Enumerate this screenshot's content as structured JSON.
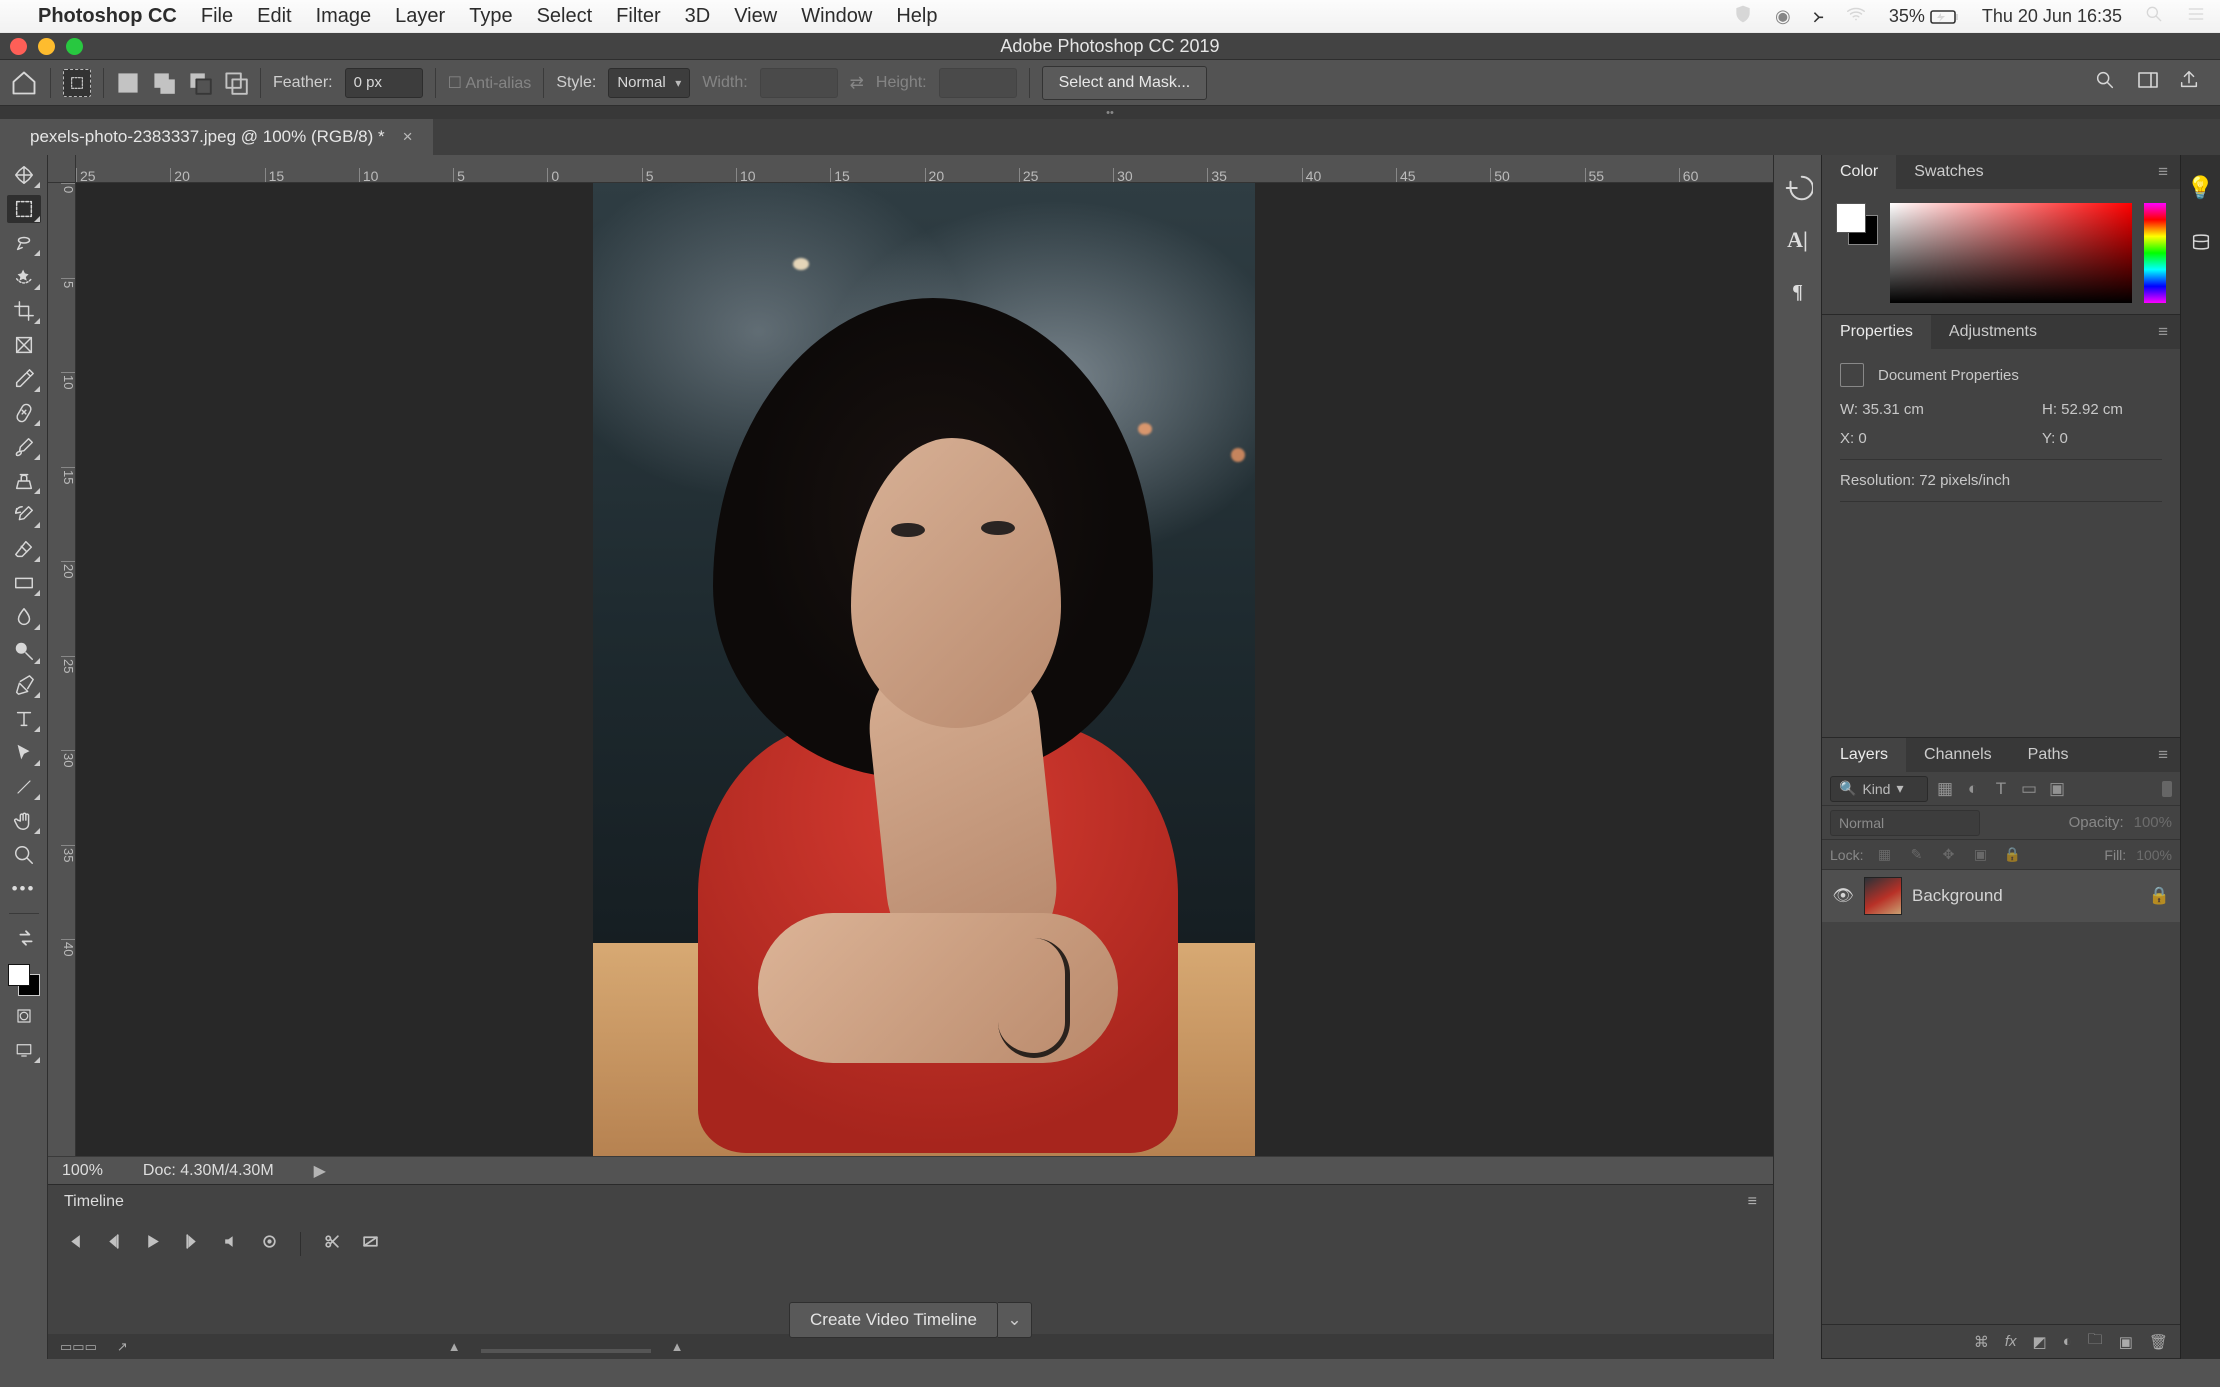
{
  "menubar": {
    "app": "Photoshop CC",
    "items": [
      "File",
      "Edit",
      "Image",
      "Layer",
      "Type",
      "Select",
      "Filter",
      "3D",
      "View",
      "Window",
      "Help"
    ],
    "battery": "35%",
    "datetime": "Thu 20 Jun  16:35"
  },
  "window": {
    "title": "Adobe Photoshop CC 2019"
  },
  "optionsbar": {
    "feather_label": "Feather:",
    "feather_value": "0 px",
    "antialias": "Anti-alias",
    "style_label": "Style:",
    "style_value": "Normal",
    "width_label": "Width:",
    "height_label": "Height:",
    "select_mask": "Select and Mask..."
  },
  "doc_tab": "pexels-photo-2383337.jpeg @ 100% (RGB/8) *",
  "ruler_h": [
    "25",
    "20",
    "15",
    "10",
    "5",
    "0",
    "5",
    "10",
    "15",
    "20",
    "25",
    "30",
    "35",
    "40",
    "45",
    "50",
    "55",
    "60"
  ],
  "ruler_v": [
    "0",
    "5",
    "10",
    "15",
    "20",
    "25",
    "30",
    "35",
    "40"
  ],
  "status": {
    "zoom": "100%",
    "doc": "Doc: 4.30M/4.30M"
  },
  "timeline": {
    "tab": "Timeline",
    "create": "Create Video Timeline"
  },
  "panels": {
    "color_tabs": [
      "Color",
      "Swatches"
    ],
    "prop_tabs": [
      "Properties",
      "Adjustments"
    ],
    "properties": {
      "title": "Document Properties",
      "w": "W: 35.31 cm",
      "h": "H: 52.92 cm",
      "x": "X: 0",
      "y": "Y: 0",
      "res": "Resolution: 72 pixels/inch"
    },
    "layer_tabs": [
      "Layers",
      "Channels",
      "Paths"
    ],
    "layers": {
      "kind": "Kind",
      "blend": "Normal",
      "opacity_lbl": "Opacity:",
      "opacity": "100%",
      "lock_lbl": "Lock:",
      "fill_lbl": "Fill:",
      "fill": "100%",
      "layer_name": "Background"
    }
  }
}
